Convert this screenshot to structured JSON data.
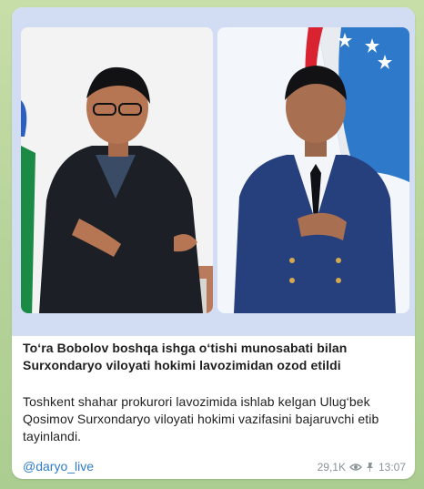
{
  "message": {
    "headline": "To‘ra Bobolov boshqa ishga o‘tishi munosabati bilan\nSurxondaryo viloyati hokimi lavozimidan ozod etildi",
    "body": "Toshkent shahar prokurori lavozimida ishlab kelgan Ulug‘bek\nQosimov Surxondaryo viloyati hokimi vazifasini bajaruvchi etib\ntayinlandi.",
    "channel_link": "@daryo_live",
    "views": "29,1K",
    "time": "13:07"
  },
  "icons": {
    "views": "eye-icon",
    "pinned": "pin-icon"
  },
  "colors": {
    "link": "#2e7bc8",
    "photo_frame": "#d2ddf3",
    "chat_background": "#b9d49a"
  }
}
